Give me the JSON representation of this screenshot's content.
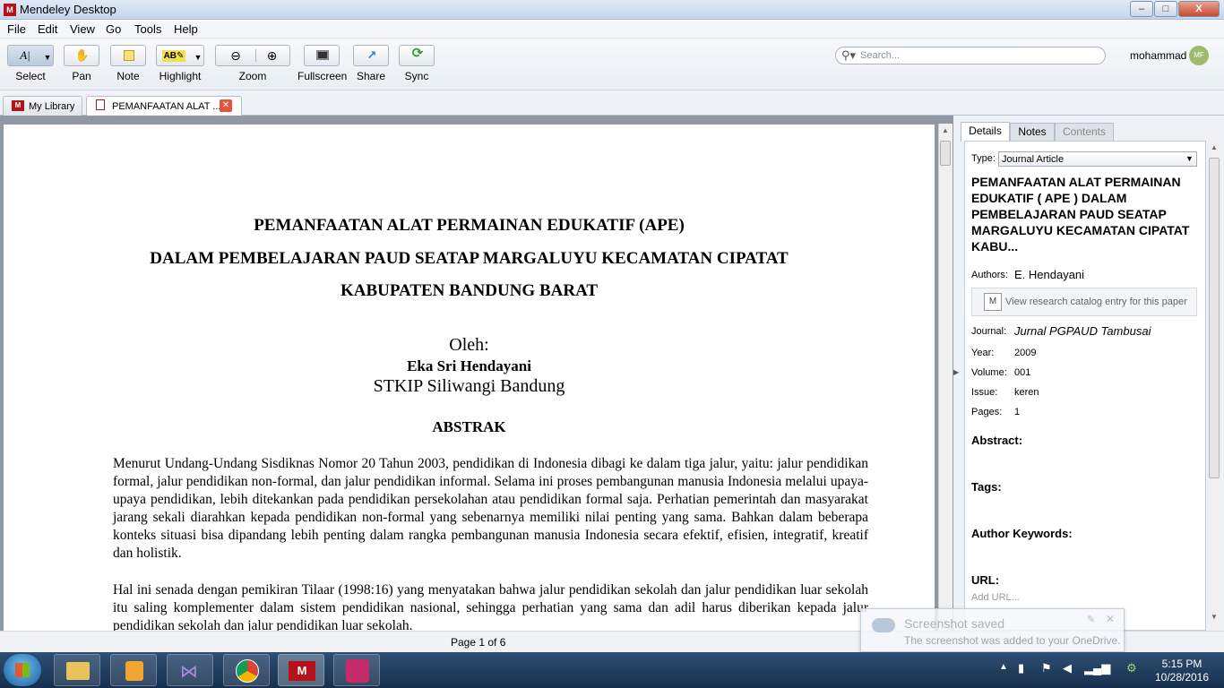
{
  "window": {
    "title": "Mendeley Desktop",
    "logo_text": "M",
    "min": "–",
    "max": "□",
    "close": "X"
  },
  "menu": [
    "File",
    "Edit",
    "View",
    "Go",
    "Tools",
    "Help"
  ],
  "toolbar": {
    "select": "Select",
    "pan": "Pan",
    "note": "Note",
    "highlight": "Highlight",
    "zoom": "Zoom",
    "fullscreen": "Fullscreen",
    "share": "Share",
    "sync": "Sync",
    "search_placeholder": "Search...",
    "user": "mohammad",
    "avatar_initials": "MF"
  },
  "tabs": {
    "library": "My Library",
    "document": "PEMANFAATAN ALAT ...",
    "close": "✕"
  },
  "document": {
    "title_l1": "PEMANFAATAN ALAT PERMAINAN EDUKATIF (APE)",
    "title_l2": "DALAM PEMBELAJARAN PAUD SEATAP MARGALUYU KECAMATAN CIPATAT",
    "title_l3": "KABUPATEN BANDUNG BARAT",
    "by": "Oleh:",
    "author": "Eka Sri Hendayani",
    "affiliation": "STKIP Siliwangi Bandung",
    "abstract_heading": "ABSTRAK",
    "para1": "Menurut Undang-Undang Sisdiknas Nomor 20 Tahun 2003, pendidikan di Indonesia dibagi ke dalam tiga jalur, yaitu: jalur pendidikan formal, jalur pendidikan non-formal, dan jalur pendidikan informal. Selama ini proses pembangunan manusia Indonesia melalui upaya-upaya pendidikan, lebih ditekankan pada pendidikan persekolahan atau pendidikan formal saja. Perhatian pemerintah dan masyarakat jarang sekali diarahkan kepada pendidikan non-formal yang sebenarnya memiliki nilai penting yang sama. Bahkan dalam beberapa konteks situasi bisa dipandang lebih penting dalam rangka pembangunan manusia Indonesia secara efektif, efisien, integratif, kreatif dan holistik.",
    "para2": "Hal ini senada dengan pemikiran Tilaar (1998:16) yang menyatakan bahwa jalur pendidikan sekolah dan jalur pendidikan luar sekolah itu saling komplementer dalam sistem pendidikan nasional, sehingga perhatian yang sama dan adil harus diberikan kepada jalur pendidikan sekolah dan jalur pendidikan luar sekolah."
  },
  "details": {
    "tab_details": "Details",
    "tab_notes": "Notes",
    "tab_contents": "Contents",
    "type_label": "Type:",
    "type_value": "Journal Article",
    "title": "PEMANFAATAN ALAT PERMAINAN EDUKATIF ( APE ) DALAM PEMBELAJARAN PAUD SEATAP MARGALUYU KECAMATAN CIPATAT KABU...",
    "authors_label": "Authors:",
    "authors_value": "E. Hendayani",
    "catalog": "View research catalog entry for this paper",
    "journal_label": "Journal:",
    "journal_value": "Jurnal PGPAUD Tambusai",
    "year_label": "Year:",
    "year_value": "2009",
    "volume_label": "Volume:",
    "volume_value": "001",
    "issue_label": "Issue:",
    "issue_value": "keren",
    "pages_label": "Pages:",
    "pages_value": "1",
    "abstract": "Abstract:",
    "tags": "Tags:",
    "keywords": "Author Keywords:",
    "url": "URL:",
    "add_url": "Add URL..."
  },
  "status": {
    "page": "Page 1 of 6"
  },
  "toast": {
    "title": "Screenshot saved",
    "body": "The screenshot was added to your OneDrive."
  },
  "taskbar": {
    "time": "5:15 PM",
    "date": "10/28/2016"
  },
  "colors": {
    "accent": "#b5121b",
    "taskbar": "#1f3b5c"
  }
}
